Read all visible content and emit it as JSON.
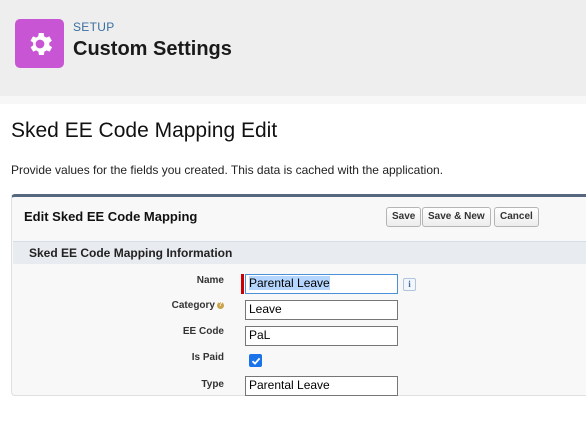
{
  "header": {
    "section_label": "SETUP",
    "title": "Custom Settings",
    "icon": "gear-icon",
    "icon_bg": "#c855d3"
  },
  "page": {
    "title": "Sked EE Code Mapping Edit",
    "description": "Provide values for the fields you created. This data is cached with the application."
  },
  "panel": {
    "title": "Edit Sked EE Code Mapping",
    "buttons": {
      "save": "Save",
      "save_new": "Save & New",
      "cancel": "Cancel"
    },
    "section_title": "Sked EE Code Mapping Information"
  },
  "fields": {
    "name": {
      "label": "Name",
      "value": "Parental Leave",
      "required": true
    },
    "category": {
      "label": "Category",
      "value": "Leave",
      "help_icon": "help-icon"
    },
    "ee_code": {
      "label": "EE Code",
      "value": "PaL"
    },
    "is_paid": {
      "label": "Is Paid",
      "checked": true
    },
    "type": {
      "label": "Type",
      "value": "Parental Leave"
    }
  },
  "colors": {
    "accent": "#1a73e8",
    "required": "#cc0000"
  }
}
